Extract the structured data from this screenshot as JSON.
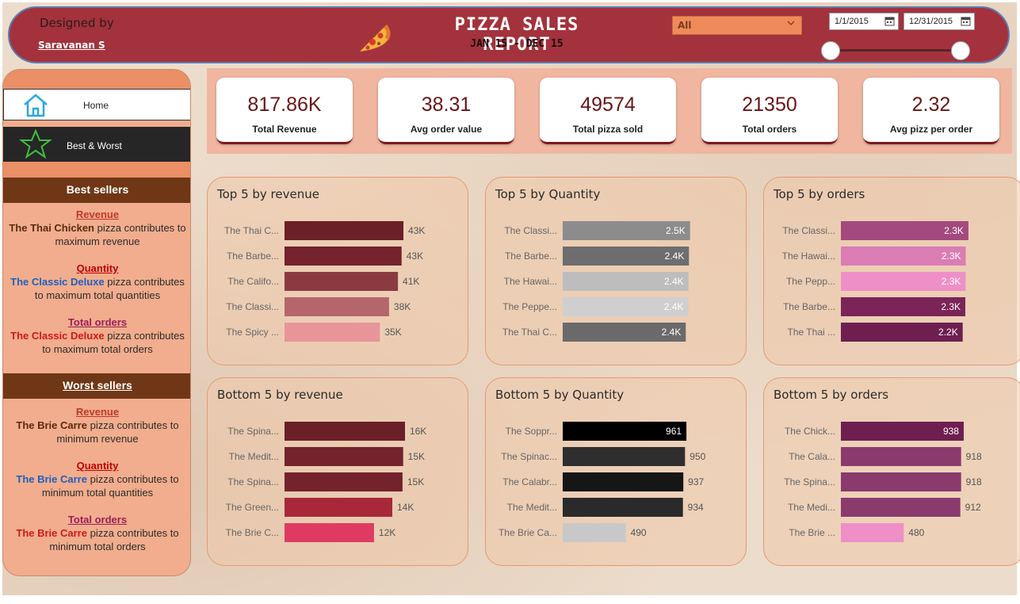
{
  "header": {
    "designed_by": "Designed by",
    "author": "Saravanan S",
    "title": "PIZZA SALES REPORT",
    "subtitle": "JAN 15 - DEC 15",
    "filter_value": "All",
    "date_start": "1/1/2015",
    "date_end": "12/31/2015",
    "date_range_fraction": [
      0.0,
      1.0
    ]
  },
  "nav": {
    "home": "Home",
    "best_worst": "Best & Worst"
  },
  "best": {
    "heading": "Best sellers",
    "revenue_title": "Revenue",
    "revenue_name": "The Thai Chicken",
    "revenue_text": "pizza contributes to maximum revenue",
    "quantity_title": "Quantity",
    "quantity_name": "The Classic Deluxe",
    "quantity_text": "pizza contributes to maximum total quantities",
    "orders_title": "Total orders",
    "orders_name": "The Classic Deluxe",
    "orders_text": "pizza contributes to maximum total orders"
  },
  "worst": {
    "heading": "Worst sellers",
    "revenue_title": "Revenue",
    "revenue_name": "The Brie Carre",
    "revenue_text": "pizza contributes to minimum revenue",
    "quantity_title": "Quantity",
    "quantity_name": "The Brie Carre",
    "quantity_text": "pizza contributes to minimum total quantities",
    "orders_title": "Total orders",
    "orders_name": "The Brie Carre",
    "orders_text": "pizza contributes to minimum total orders"
  },
  "kpis": [
    {
      "value": "817.86K",
      "label": "Total Revenue"
    },
    {
      "value": "38.31",
      "label": "Avg order value"
    },
    {
      "value": "49574",
      "label": "Total pizza sold"
    },
    {
      "value": "21350",
      "label": "Total orders"
    },
    {
      "value": "2.32",
      "label": "Avg pizz per order"
    }
  ],
  "colors": {
    "header": "#a3323d",
    "kpi_value": "#6b1414",
    "best_revenue_name": "#5a2a0f",
    "quantity_name": "#1f5fbf",
    "orders_name": "#d01818",
    "revenue_title": "#c0392b",
    "quantity_title": "#c00000",
    "orders_title": "#9b1f5a"
  },
  "chart_data": [
    {
      "type": "bar",
      "orientation": "horizontal",
      "title": "Top 5 by revenue",
      "categories": [
        "The Thai C...",
        "The Barbe...",
        "The Califo...",
        "The Classi...",
        "The Spicy ..."
      ],
      "values": [
        43434,
        42768,
        41410,
        38180,
        34831
      ],
      "value_labels": [
        "43K",
        "43K",
        "41K",
        "38K",
        "35K"
      ],
      "colors": [
        "#6b1f26",
        "#74222b",
        "#8b3a42",
        "#b5666b",
        "#e8959a"
      ],
      "label_inside": false,
      "xlim": [
        0,
        55000
      ]
    },
    {
      "type": "bar",
      "orientation": "horizontal",
      "title": "Top 5 by Quantity",
      "categories": [
        "The Classi...",
        "The Barbe...",
        "The Hawai...",
        "The Peppe...",
        "The Thai C..."
      ],
      "values": [
        2453,
        2432,
        2422,
        2418,
        2371
      ],
      "value_labels": [
        "2.5K",
        "2.4K",
        "2.4K",
        "2.4K",
        "2.4K"
      ],
      "colors": [
        "#8c8c8c",
        "#6e6e6e",
        "#bdbdbd",
        "#cfcfcf",
        "#6a6a6a"
      ],
      "label_inside": true,
      "xlim": [
        0,
        2900
      ]
    },
    {
      "type": "bar",
      "orientation": "horizontal",
      "title": "Top 5 by orders",
      "categories": [
        "The Classi...",
        "The Hawai...",
        "The Pepp...",
        "The Barbe...",
        "The Thai ..."
      ],
      "values": [
        2329,
        2280,
        2278,
        2273,
        2225
      ],
      "value_labels": [
        "2.3K",
        "2.3K",
        "2.3K",
        "2.3K",
        "2.2K"
      ],
      "colors": [
        "#a4497f",
        "#d97db4",
        "#ee8fc7",
        "#7a2458",
        "#6e1f50"
      ],
      "label_inside": true,
      "xlim": [
        0,
        2750
      ]
    },
    {
      "type": "bar",
      "orientation": "horizontal",
      "title": "Bottom 5 by revenue",
      "categories": [
        "The Spina...",
        "The Medit...",
        "The Spina...",
        "The Green...",
        "The Brie C..."
      ],
      "values": [
        15596,
        15360,
        15277,
        13956,
        11588
      ],
      "value_labels": [
        "16K",
        "15K",
        "15K",
        "14K",
        "12K"
      ],
      "colors": [
        "#6b1f26",
        "#74222b",
        "#74222b",
        "#a8283a",
        "#df3b62"
      ],
      "label_inside": false,
      "xlim": [
        0,
        19500
      ]
    },
    {
      "type": "bar",
      "orientation": "horizontal",
      "title": "Bottom 5 by Quantity",
      "categories": [
        "The Soppr...",
        "The Spinac...",
        "The Calabr...",
        "The Medit...",
        "The Brie Ca..."
      ],
      "values": [
        961,
        950,
        937,
        934,
        490
      ],
      "value_labels": [
        "961",
        "950",
        "937",
        "934",
        "490"
      ],
      "colors": [
        "#000000",
        "#2e2e2e",
        "#161616",
        "#2a2a2a",
        "#c8c8c8"
      ],
      "label_inside": [
        true,
        false,
        false,
        false,
        false
      ],
      "xlim": [
        0,
        1170
      ]
    },
    {
      "type": "bar",
      "orientation": "horizontal",
      "title": "Bottom 5 by orders",
      "categories": [
        "The Chick...",
        "The Cala...",
        "The Spina...",
        "The Medi...",
        "The Brie ..."
      ],
      "values": [
        938,
        918,
        918,
        912,
        480
      ],
      "value_labels": [
        "938",
        "918",
        "918",
        "912",
        "480"
      ],
      "colors": [
        "#6e1f50",
        "#8b3a6e",
        "#8b3a6e",
        "#8b3a6e",
        "#ee8fc7"
      ],
      "label_inside": [
        true,
        false,
        false,
        false,
        false
      ],
      "xlim": [
        0,
        1150
      ]
    }
  ]
}
